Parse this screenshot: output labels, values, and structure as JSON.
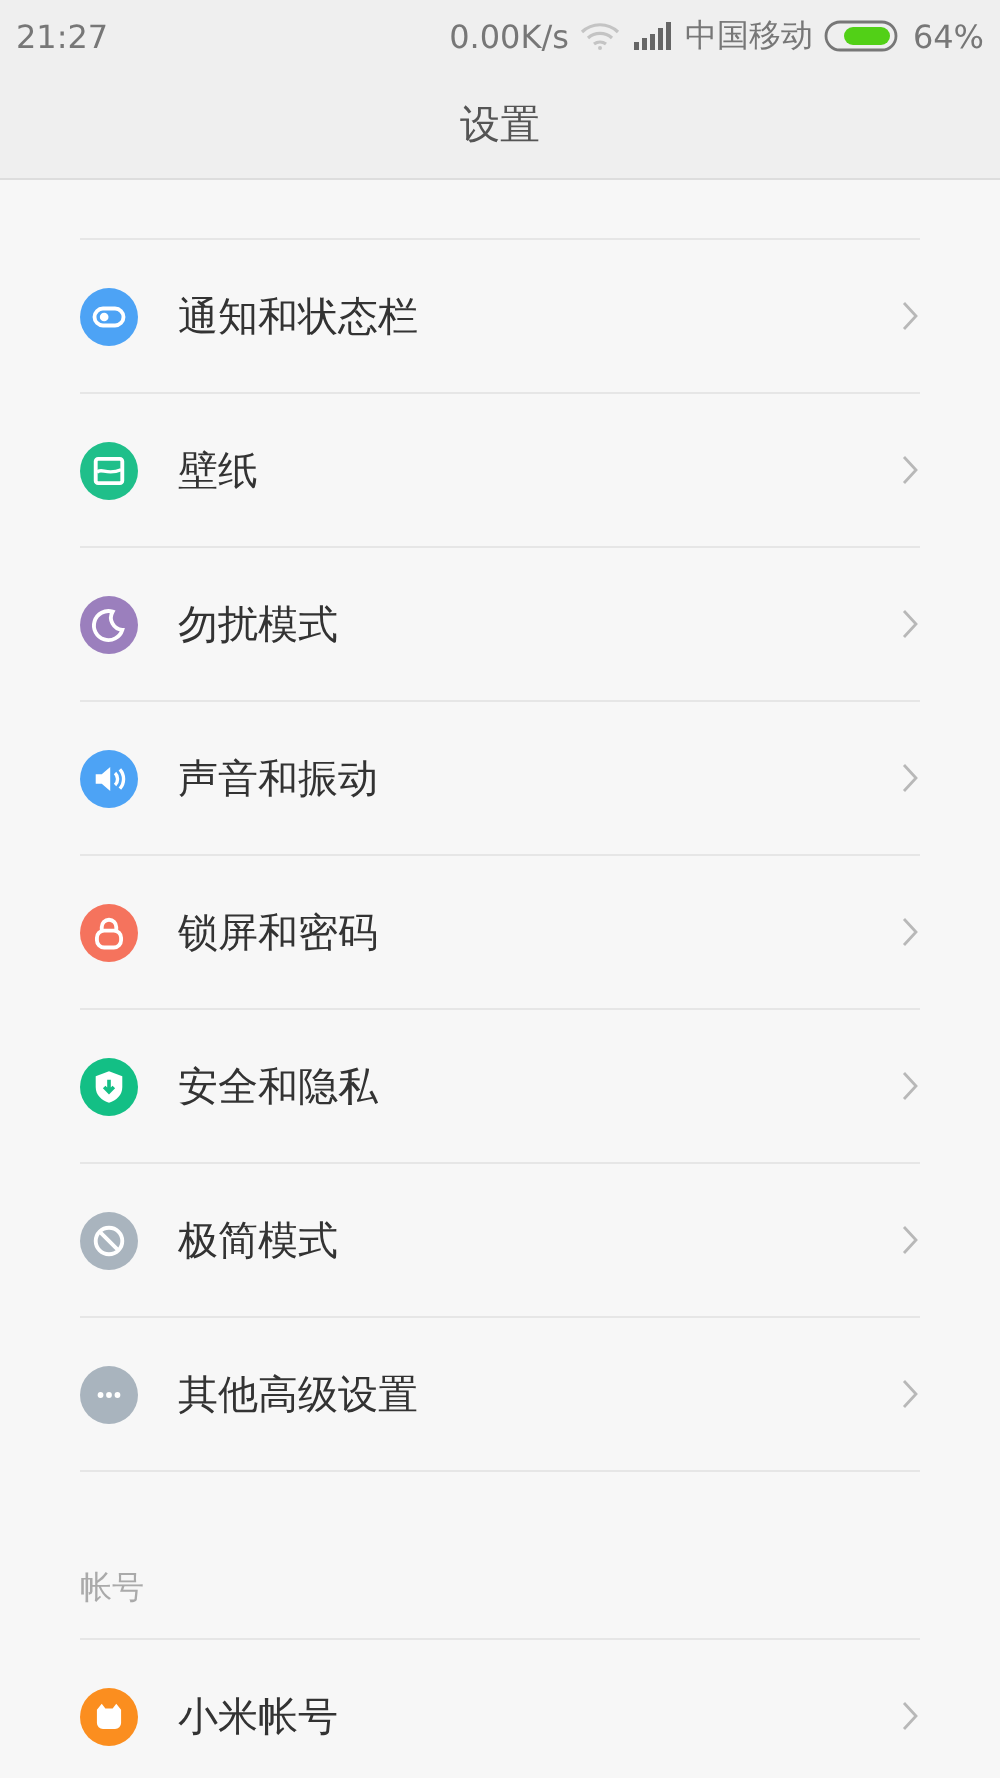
{
  "status_bar": {
    "time": "21:27",
    "speed": "0.00K/s",
    "carrier": "中国移动",
    "battery": "64%"
  },
  "title": "设置",
  "items": [
    {
      "label": "通知和状态栏",
      "color": "#4da3f5"
    },
    {
      "label": "壁纸",
      "color": "#1fbf8a"
    },
    {
      "label": "勿扰模式",
      "color": "#9b7fbd"
    },
    {
      "label": "声音和振动",
      "color": "#4da3f5"
    },
    {
      "label": "锁屏和密码",
      "color": "#f5735d"
    },
    {
      "label": "安全和隐私",
      "color": "#13bf85"
    },
    {
      "label": "极简模式",
      "color": "#a9b4be"
    },
    {
      "label": "其他高级设置",
      "color": "#a9b4be"
    }
  ],
  "account_section": {
    "header": "帐号",
    "items": [
      {
        "label": "小米帐号",
        "color": "#fb8e1f"
      }
    ]
  }
}
